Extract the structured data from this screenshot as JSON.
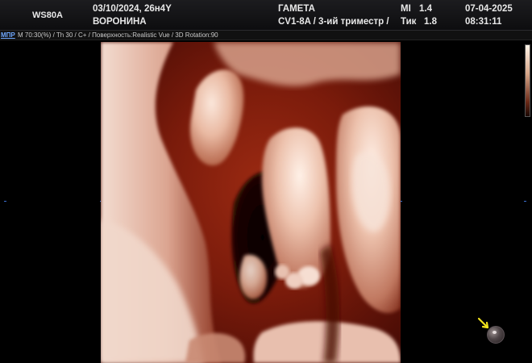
{
  "header": {
    "model": "WS80A",
    "date_age": "03/10/2024, 26н4Y",
    "patient": "ВОРОНИНА",
    "preset": "ГАМЕТА",
    "probe_info": "CV1-8A / 3-ий триместр /",
    "mi_label": "MI",
    "mi_value": "1.4",
    "tic_label": "Тик",
    "tic_value": "1.8",
    "exam_date": "07-04-2025",
    "exam_time": "08:31:11"
  },
  "param_strip": {
    "mode_tab": "МПР",
    "params": "M 70:30(%) / Th 30 / C+ / Поверхность:Realistic Vue / 3D Rotation:90"
  },
  "image": {
    "description_colors": {
      "flesh": "#e7b8a0",
      "shadow": "#6e1409",
      "background": "#000000"
    },
    "orientation_marker": "orientation-ball-icon",
    "marker_arrow_color": "#f2e21c"
  }
}
